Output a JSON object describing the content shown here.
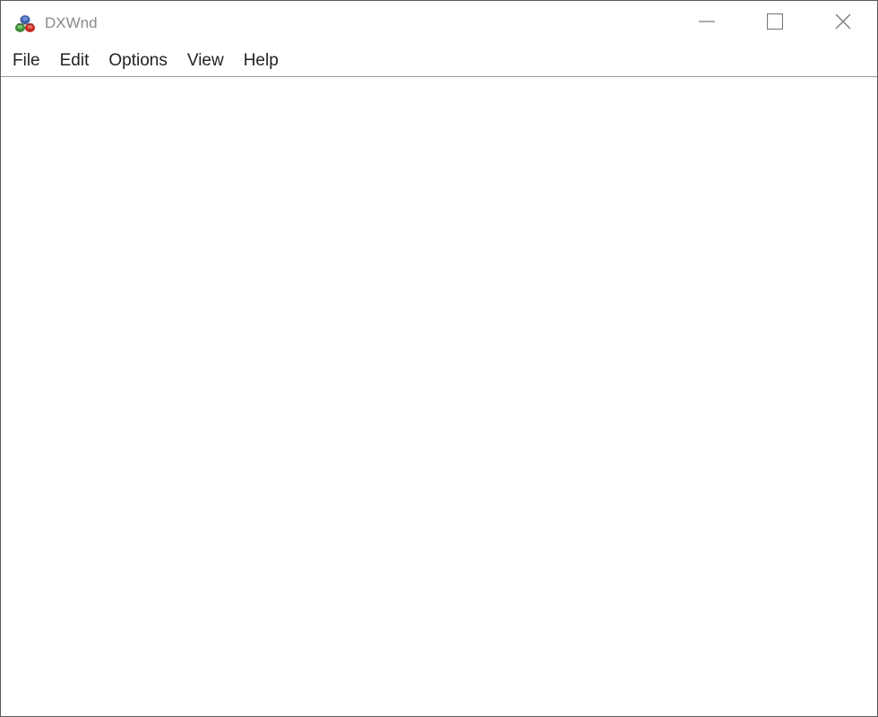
{
  "window": {
    "title": "DXWnd",
    "icon": "dxwnd-app-icon"
  },
  "caption_buttons": {
    "minimize_icon": "minimize-icon",
    "maximize_icon": "maximize-icon",
    "close_icon": "close-icon"
  },
  "menu": {
    "items": [
      {
        "label": "File"
      },
      {
        "label": "Edit"
      },
      {
        "label": "Options"
      },
      {
        "label": "View"
      },
      {
        "label": "Help"
      }
    ]
  },
  "colors": {
    "border": "#5a5a5a",
    "title_text": "#8a8a8a",
    "menu_text": "#222222",
    "background": "#ffffff"
  }
}
